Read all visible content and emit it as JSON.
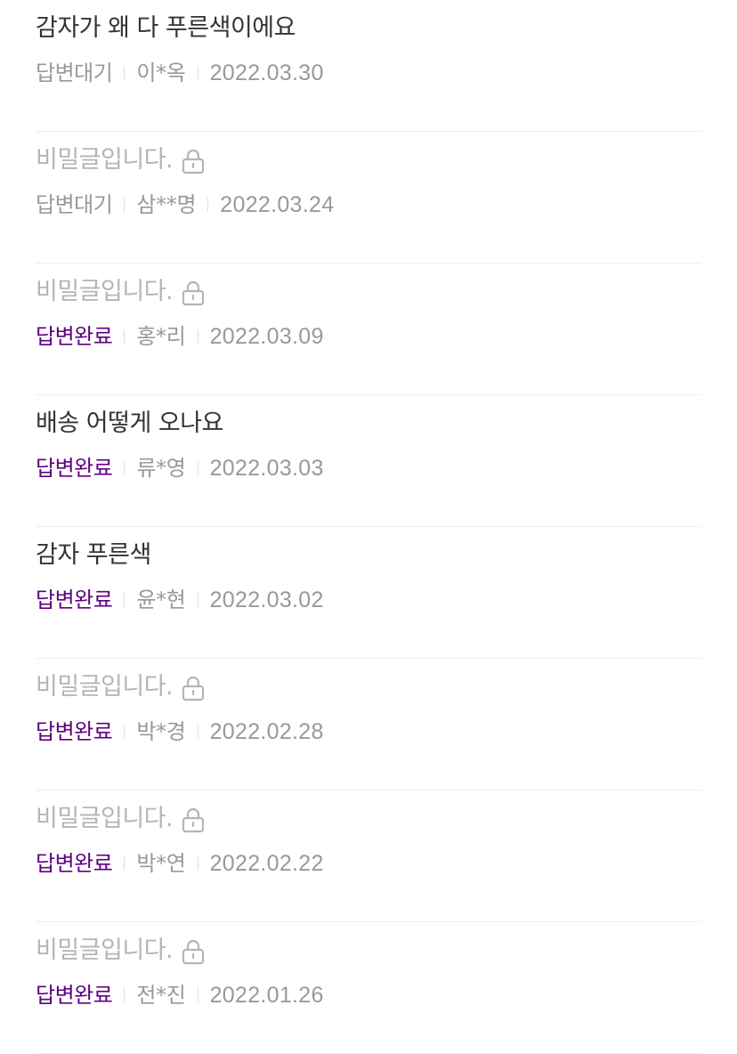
{
  "colors": {
    "title_text": "#333333",
    "secret_text": "#b5b5b5",
    "meta_text": "#999999",
    "status_done": "#5f0080",
    "divider": "#eeeeee"
  },
  "posts": [
    {
      "title": "감자가 왜 다 푸른색이에요",
      "secret": false,
      "status": "답변대기",
      "status_done": false,
      "writer": "이*옥",
      "date": "2022.03.30"
    },
    {
      "title": "비밀글입니다.",
      "secret": true,
      "lock_icon": "lock-icon",
      "status": "답변대기",
      "status_done": false,
      "writer": "삼**명",
      "date": "2022.03.24"
    },
    {
      "title": "비밀글입니다.",
      "secret": true,
      "lock_icon": "lock-icon",
      "status": "답변완료",
      "status_done": true,
      "writer": "홍*리",
      "date": "2022.03.09"
    },
    {
      "title": "배송 어떻게 오나요",
      "secret": false,
      "status": "답변완료",
      "status_done": true,
      "writer": "류*영",
      "date": "2022.03.03"
    },
    {
      "title": "감자 푸른색",
      "secret": false,
      "status": "답변완료",
      "status_done": true,
      "writer": "윤*현",
      "date": "2022.03.02"
    },
    {
      "title": "비밀글입니다.",
      "secret": true,
      "lock_icon": "lock-icon",
      "status": "답변완료",
      "status_done": true,
      "writer": "박*경",
      "date": "2022.02.28"
    },
    {
      "title": "비밀글입니다.",
      "secret": true,
      "lock_icon": "lock-icon",
      "status": "답변완료",
      "status_done": true,
      "writer": "박*연",
      "date": "2022.02.22"
    },
    {
      "title": "비밀글입니다.",
      "secret": true,
      "lock_icon": "lock-icon",
      "status": "답변완료",
      "status_done": true,
      "writer": "전*진",
      "date": "2022.01.26"
    }
  ]
}
